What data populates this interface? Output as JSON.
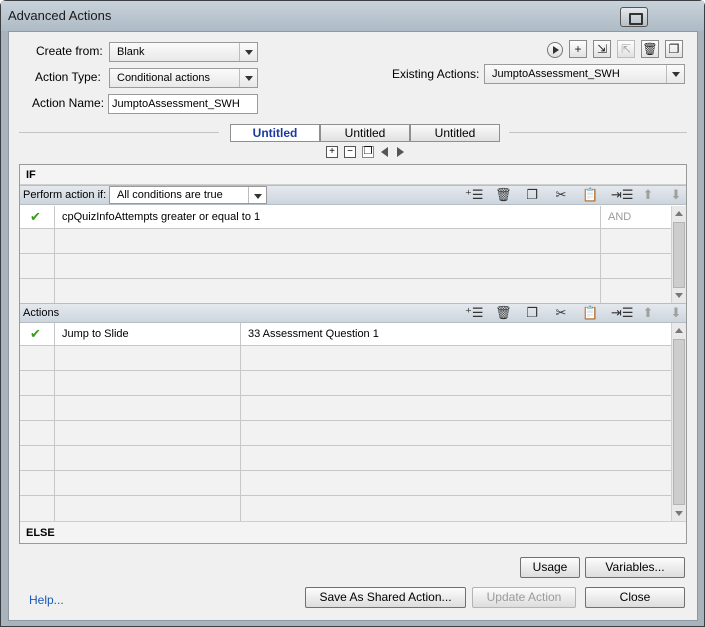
{
  "window": {
    "title": "Advanced Actions"
  },
  "form": {
    "create_from_label": "Create from:",
    "create_from_value": "Blank",
    "action_type_label": "Action Type:",
    "action_type_value": "Conditional actions",
    "action_name_label": "Action Name:",
    "action_name_value": "JumptoAssessment_SWH",
    "existing_actions_label": "Existing Actions:",
    "existing_actions_value": "JumptoAssessment_SWH"
  },
  "toolbar": {
    "icons": [
      "preview-icon",
      "add-action-icon",
      "import-icon",
      "export-icon",
      "delete-icon",
      "duplicate-icon"
    ]
  },
  "tabs": [
    {
      "label": "Untitled",
      "active": true
    },
    {
      "label": "Untitled",
      "active": false
    },
    {
      "label": "Untitled",
      "active": false
    }
  ],
  "if_section": {
    "header": "IF",
    "perform_label": "Perform action if:",
    "perform_value": "All conditions are true",
    "conditions": [
      {
        "checked": true,
        "text": "cpQuizInfoAttempts    greater or equal to    1",
        "operator": "AND"
      }
    ]
  },
  "actions_section": {
    "header": "Actions",
    "rows": [
      {
        "checked": true,
        "action": "Jump to Slide",
        "target": "33 Assessment Question 1"
      }
    ]
  },
  "else_section": {
    "header": "ELSE"
  },
  "buttons": {
    "usage": "Usage",
    "variables": "Variables...",
    "save_shared": "Save As Shared Action...",
    "update": "Update Action",
    "close": "Close",
    "help": "Help..."
  }
}
